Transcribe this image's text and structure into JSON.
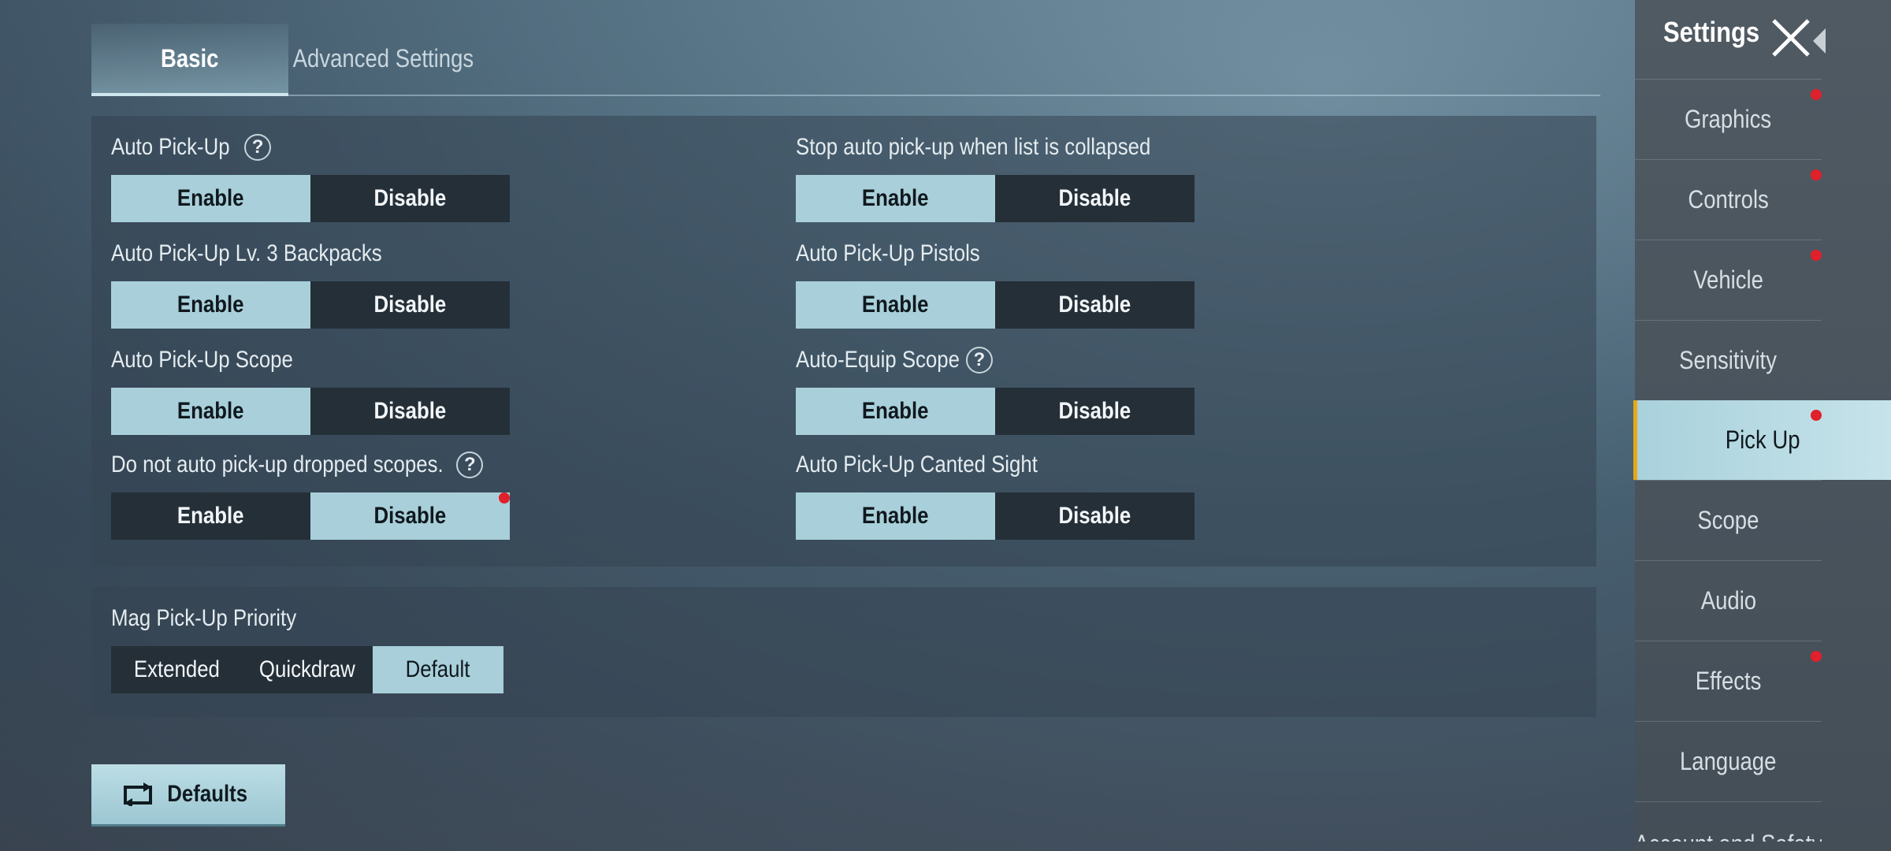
{
  "tabs": {
    "basic": "Basic",
    "advanced": "Advanced Settings"
  },
  "settings": [
    {
      "label": "Auto Pick-Up",
      "help": true,
      "enable": "Enable",
      "disable": "Disable",
      "selected": "enable"
    },
    {
      "label": "Stop auto pick-up when list is collapsed",
      "help": false,
      "enable": "Enable",
      "disable": "Disable",
      "selected": "enable"
    },
    {
      "label": "Auto Pick-Up Lv. 3 Backpacks",
      "help": false,
      "enable": "Enable",
      "disable": "Disable",
      "selected": "enable"
    },
    {
      "label": "Auto Pick-Up Pistols",
      "help": false,
      "enable": "Enable",
      "disable": "Disable",
      "selected": "enable"
    },
    {
      "label": "Auto Pick-Up Scope",
      "help": false,
      "enable": "Enable",
      "disable": "Disable",
      "selected": "enable"
    },
    {
      "label": "Auto-Equip Scope",
      "help": true,
      "enable": "Enable",
      "disable": "Disable",
      "selected": "enable"
    },
    {
      "label": "Do not auto pick-up dropped scopes.",
      "help": true,
      "enable": "Enable",
      "disable": "Disable",
      "selected": "disable"
    },
    {
      "label": "Auto Pick-Up Canted Sight",
      "help": false,
      "enable": "Enable",
      "disable": "Disable",
      "selected": "enable"
    }
  ],
  "help_glyph": "?",
  "mag": {
    "label": "Mag Pick-Up Priority",
    "options": [
      "Extended",
      "Quickdraw",
      "Default"
    ],
    "selected": "Default"
  },
  "defaults_button": "Defaults",
  "sidebar": {
    "title": "Settings",
    "items": [
      {
        "label": "Graphics",
        "badge": true
      },
      {
        "label": "Controls",
        "badge": true
      },
      {
        "label": "Vehicle",
        "badge": true
      },
      {
        "label": "Sensitivity",
        "badge": false
      },
      {
        "label": "Pick Up",
        "badge": true,
        "active": true
      },
      {
        "label": "Scope",
        "badge": false
      },
      {
        "label": "Audio",
        "badge": false
      },
      {
        "label": "Effects",
        "badge": true
      },
      {
        "label": "Language",
        "badge": false
      },
      {
        "label": "Account and Safety",
        "badge": false
      }
    ]
  },
  "colors": {
    "selected": "#a9d0da",
    "unselected": "#252f38",
    "badge": "#e0202a",
    "active_bar": "#e7a918"
  }
}
